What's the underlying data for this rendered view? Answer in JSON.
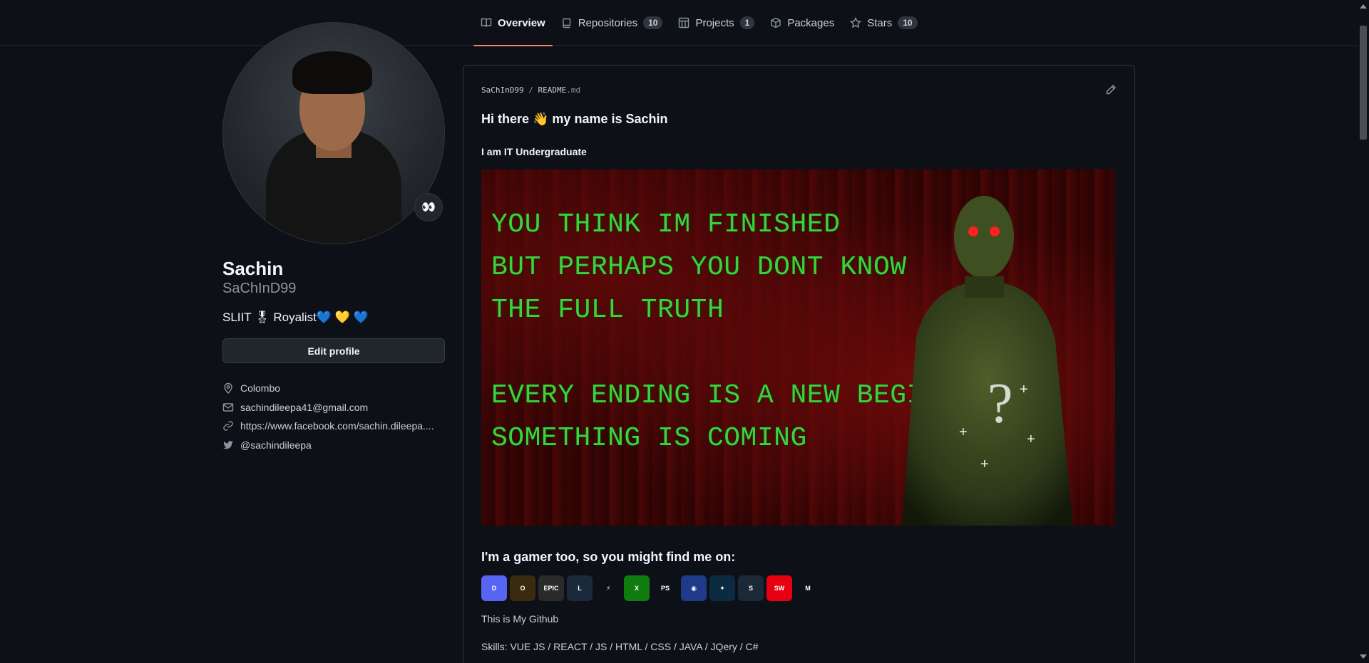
{
  "tabs": [
    {
      "label": "Overview",
      "count": null,
      "active": true,
      "icon": "book-icon"
    },
    {
      "label": "Repositories",
      "count": "10",
      "icon": "repo-icon"
    },
    {
      "label": "Projects",
      "count": "1",
      "icon": "project-icon"
    },
    {
      "label": "Packages",
      "count": null,
      "icon": "package-icon"
    },
    {
      "label": "Stars",
      "count": "10",
      "icon": "star-icon"
    }
  ],
  "profile": {
    "fullname": "Sachin",
    "username": "SaChInD99",
    "bio": "SLIIT 🎖 Royalist💙 💛 💙",
    "status_emoji": "👀",
    "edit_label": "Edit profile",
    "location": "Colombo",
    "email": "sachindileepa41@gmail.com",
    "website": "https://www.facebook.com/sachin.dileepa....",
    "twitter": "@sachindileepa"
  },
  "readme": {
    "owner": "SaChInD99",
    "separator": "/",
    "file": "README",
    "ext": ".md",
    "greeting": "Hi there 👋 my name is Sachin",
    "subtitle": "I am IT Undergraduate",
    "banner_lines": [
      "YOU THINK IM FINISHED",
      "BUT PERHAPS YOU DONT KNOW",
      "THE FULL TRUTH",
      "",
      "EVERY ENDING IS A NEW BEGINNING",
      "SOMETHING IS COMING"
    ],
    "gamer_heading": "I'm a gamer too, so you might find me on:",
    "game_icons": [
      {
        "name": "discord-icon",
        "bg": "#5865f2",
        "label": "D"
      },
      {
        "name": "ring-icon",
        "bg": "#3a2a10",
        "label": "O"
      },
      {
        "name": "epic-games-icon",
        "bg": "#2a2a2a",
        "label": "EPIC"
      },
      {
        "name": "league-icon",
        "bg": "#1a2a3a",
        "label": "L"
      },
      {
        "name": "battlenet-icon",
        "bg": "#0d1117",
        "label": "⚡"
      },
      {
        "name": "xbox-icon",
        "bg": "#107c10",
        "label": "X"
      },
      {
        "name": "playstation-icon",
        "bg": "#0d1117",
        "label": "PS"
      },
      {
        "name": "pokemon-icon",
        "bg": "#1f3a8a",
        "label": "◉"
      },
      {
        "name": "starcraft-icon",
        "bg": "#0b2b40",
        "label": "✦"
      },
      {
        "name": "steam-icon",
        "bg": "#1b2838",
        "label": "S"
      },
      {
        "name": "switch-icon",
        "bg": "#e60012",
        "label": "SW"
      },
      {
        "name": "mtg-icon",
        "bg": "#0d1117",
        "label": "M"
      }
    ],
    "github_line": "This is My Github",
    "skills_line": "Skills: VUE JS / REACT / JS / HTML / CSS / JAVA / JQery / C#"
  }
}
